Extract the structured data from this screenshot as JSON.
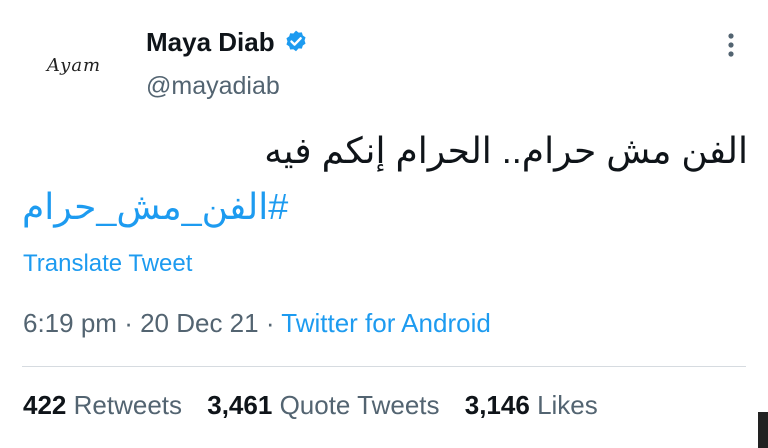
{
  "user": {
    "display_name": "Maya Diab",
    "handle": "@mayadiab",
    "avatar_text": "Ayam"
  },
  "tweet": {
    "text": "الفن مش حرام..  الحرام إنكم فيه",
    "hashtag": "#الفن_مش_حرام",
    "translate_label": "Translate Tweet",
    "time": "6:19 pm",
    "date": "20 Dec 21",
    "source": "Twitter for Android"
  },
  "stats": {
    "retweets": {
      "count": "422",
      "label": "Retweets"
    },
    "quotes": {
      "count": "3,461",
      "label": "Quote Tweets"
    },
    "likes": {
      "count": "3,146",
      "label": "Likes"
    }
  },
  "colors": {
    "accent": "#1d9bf0",
    "muted": "#536471",
    "text": "#0f1419"
  },
  "icons": {
    "verified": "verified-badge-icon",
    "more": "more-options-icon"
  }
}
